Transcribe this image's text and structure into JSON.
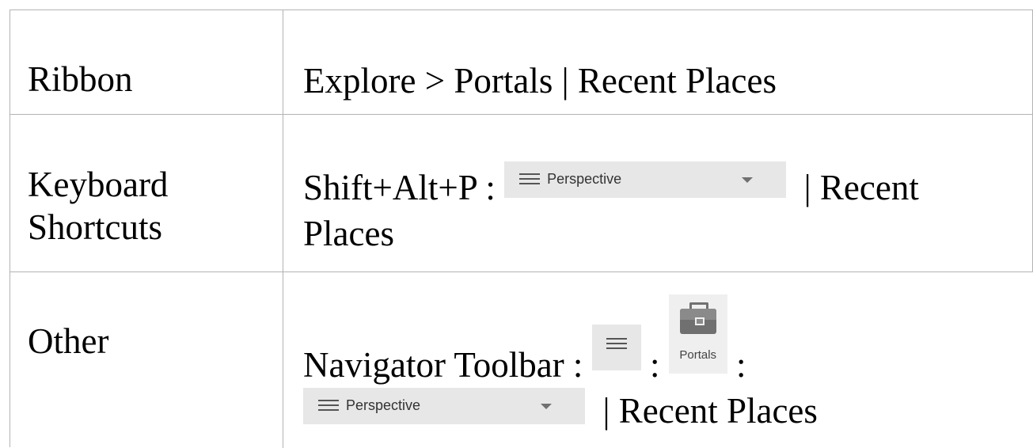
{
  "rows": {
    "ribbon": {
      "label": "Ribbon",
      "value": "Explore > Portals | Recent Places"
    },
    "keyboard": {
      "label_line1": "Keyboard",
      "label_line2": "Shortcuts",
      "prefix": "Shift+Alt+P : ",
      "suffix": "| Recent",
      "line2": "Places"
    },
    "other": {
      "label": "Other",
      "prefix": "Navigator Toolbar : ",
      "sep1": " : ",
      "sep2": " :",
      "suffix": "| Recent Places"
    }
  },
  "widgets": {
    "perspective_label": "Perspective",
    "portals_label": "Portals"
  },
  "icons": {
    "menu": "hamburger-menu-icon",
    "dropdown": "chevron-down-icon",
    "portals": "briefcase-icon"
  },
  "colors": {
    "grid_line": "#b3b3b3",
    "widget_bg": "#e7e7e7",
    "icon_gray": "#707070"
  }
}
